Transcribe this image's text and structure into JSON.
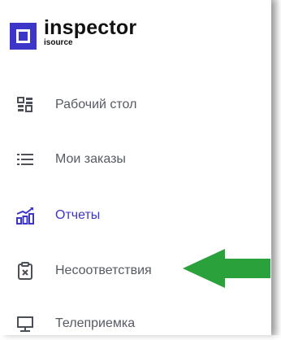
{
  "brand": {
    "name": "inspector",
    "sub": "isource"
  },
  "nav": {
    "items": [
      {
        "label": "Рабочий стол",
        "icon": "dashboard-icon",
        "active": false
      },
      {
        "label": "Мои заказы",
        "icon": "list-icon",
        "active": false
      },
      {
        "label": "Отчеты",
        "icon": "bar-chart-icon",
        "active": true
      },
      {
        "label": "Несоответствия",
        "icon": "clipboard-x-icon",
        "active": false
      },
      {
        "label": "Телеприемка",
        "icon": "monitor-icon",
        "active": false
      }
    ]
  },
  "colors": {
    "accent": "#3d35c8",
    "text": "#555a63",
    "arrow": "#2aa13a"
  }
}
